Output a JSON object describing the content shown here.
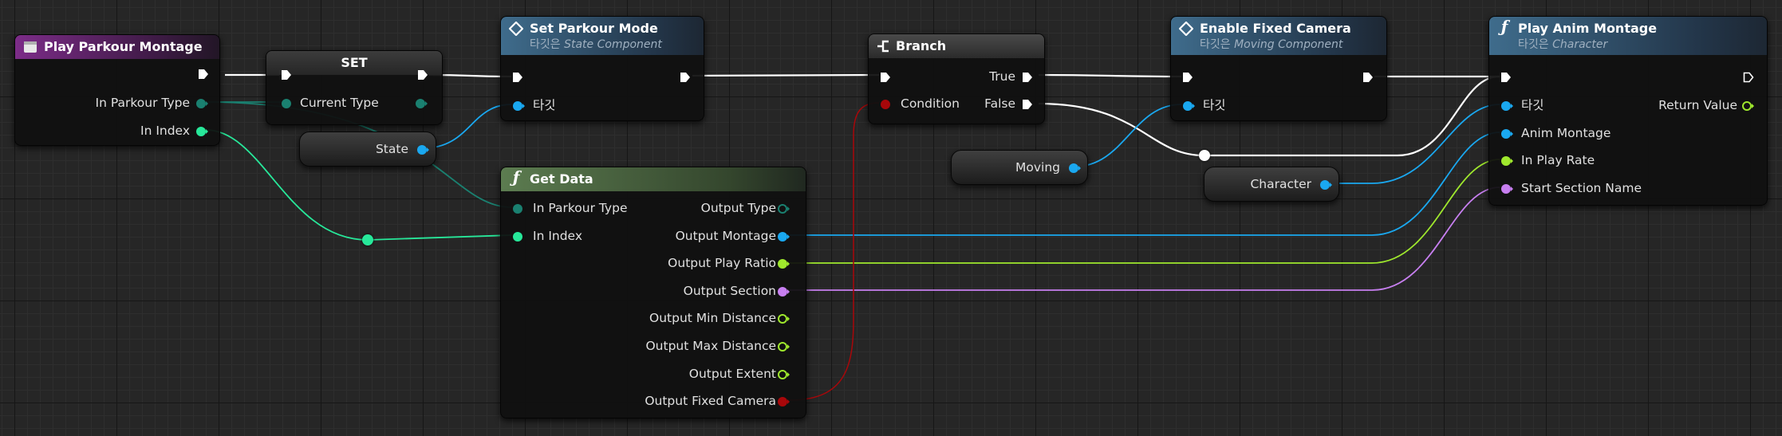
{
  "colors": {
    "exec": "#ffffff",
    "struct_enum": "#1a8070",
    "int": "#27e89a",
    "object": "#1aa8f0",
    "float": "#9fe82d",
    "name": "#c77ff0",
    "bool": "#a8070a",
    "vector": "#f2d43a"
  },
  "nodes": {
    "play_parkour_montage": {
      "title": "Play Parkour Montage",
      "pins": {
        "in_parkour_type": "In Parkour Type",
        "in_index": "In Index"
      }
    },
    "set_node": {
      "title": "SET",
      "pins": {
        "current_type": "Current Type"
      }
    },
    "set_parkour_mode": {
      "title": "Set Parkour Mode",
      "subtitle_prefix": "타깃은",
      "subtitle_target": "State Component",
      "pins": {
        "target": "타깃"
      }
    },
    "state_var": {
      "label": "State"
    },
    "get_data": {
      "title": "Get Data",
      "inputs": {
        "in_parkour_type": "In Parkour Type",
        "in_index": "In Index"
      },
      "outputs": {
        "type": "Output Type",
        "montage": "Output Montage",
        "play_ratio": "Output Play Ratio",
        "section": "Output Section",
        "min_distance": "Output Min Distance",
        "max_distance": "Output Max Distance",
        "extent": "Output Extent",
        "fixed_camera": "Output Fixed Camera"
      }
    },
    "branch": {
      "title": "Branch",
      "pins": {
        "condition": "Condition",
        "true": "True",
        "false": "False"
      }
    },
    "enable_fixed_camera": {
      "title": "Enable Fixed Camera",
      "subtitle_prefix": "타깃은",
      "subtitle_target": "Moving Component",
      "pins": {
        "target": "타깃"
      }
    },
    "moving_var": {
      "label": "Moving"
    },
    "character_var": {
      "label": "Character"
    },
    "play_anim_montage": {
      "title": "Play Anim Montage",
      "subtitle_prefix": "타깃은",
      "subtitle_target": "Character",
      "pins": {
        "target": "타깃",
        "anim_montage": "Anim Montage",
        "in_play_rate": "In Play Rate",
        "start_section_name": "Start Section Name",
        "return_value": "Return Value"
      }
    }
  }
}
